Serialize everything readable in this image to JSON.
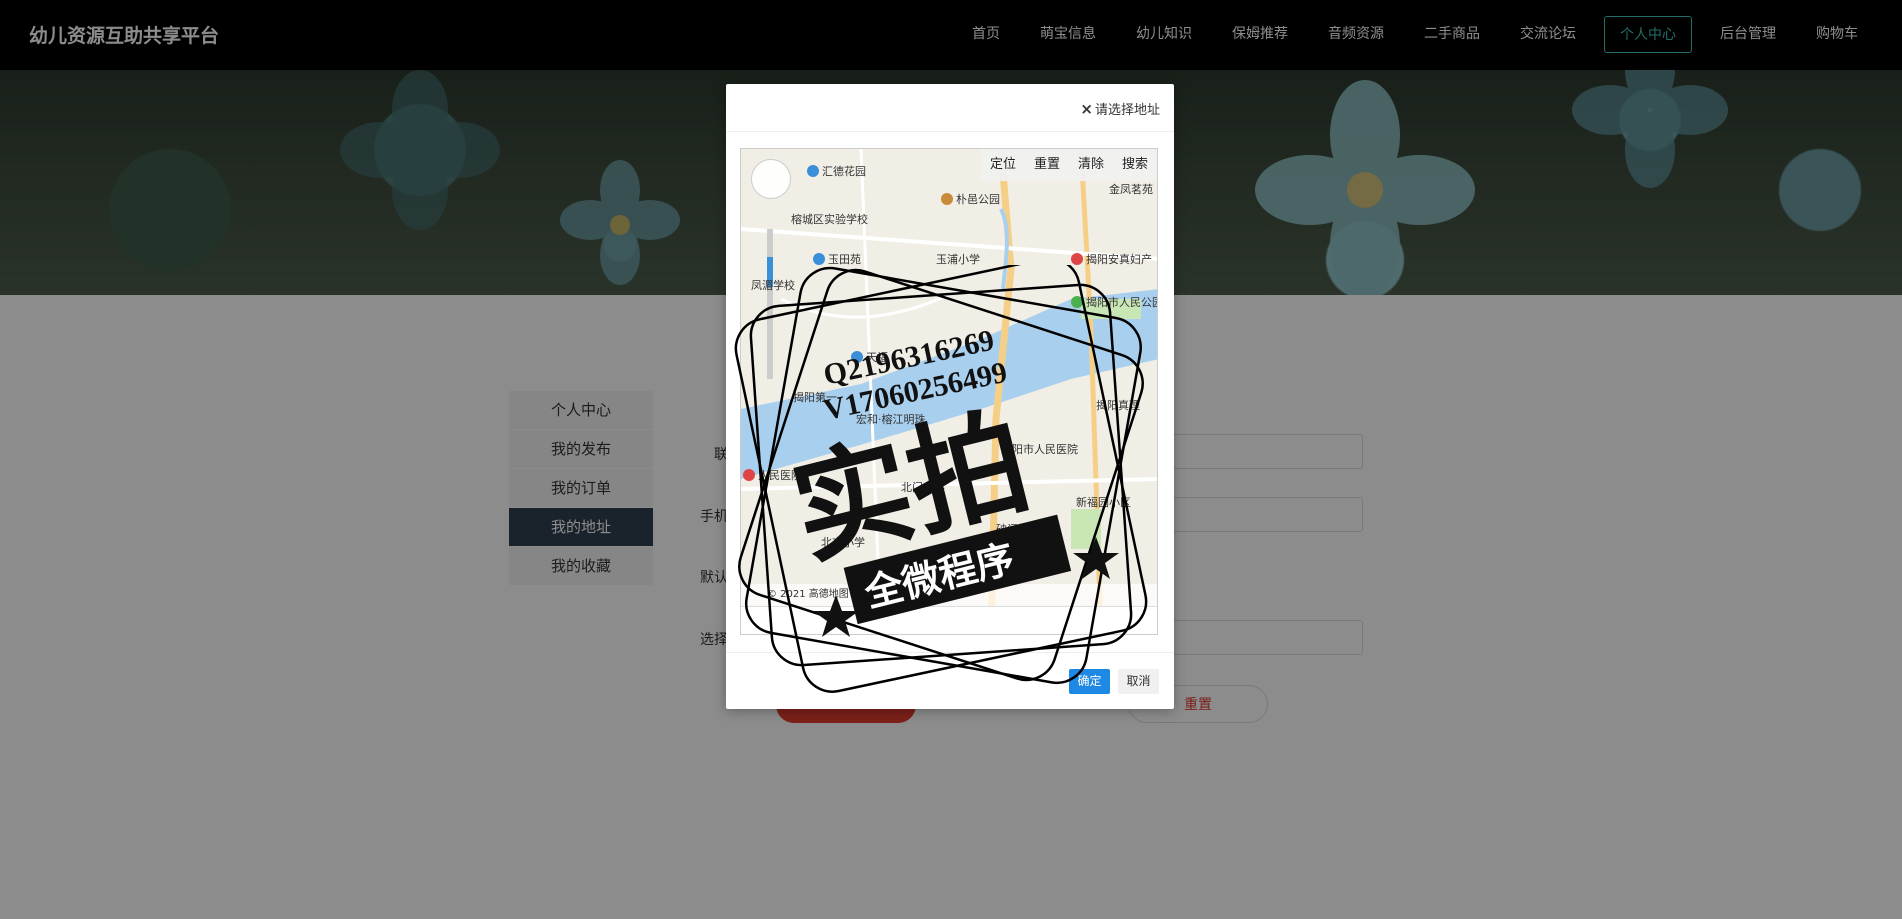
{
  "brand": "幼儿资源互助共享平台",
  "nav": [
    {
      "label": "首页",
      "active": false
    },
    {
      "label": "萌宝信息",
      "active": false
    },
    {
      "label": "幼儿知识",
      "active": false
    },
    {
      "label": "保姆推荐",
      "active": false
    },
    {
      "label": "音频资源",
      "active": false
    },
    {
      "label": "二手商品",
      "active": false
    },
    {
      "label": "交流论坛",
      "active": false
    },
    {
      "label": "个人中心",
      "active": true
    },
    {
      "label": "后台管理",
      "active": false
    },
    {
      "label": "购物车",
      "active": false
    }
  ],
  "sidebar": {
    "items": [
      {
        "label": "个人中心",
        "active": false
      },
      {
        "label": "我的发布",
        "active": false
      },
      {
        "label": "我的订单",
        "active": false
      },
      {
        "label": "我的地址",
        "active": true
      },
      {
        "label": "我的收藏",
        "active": false
      }
    ]
  },
  "form": {
    "labels": [
      "联",
      "手机",
      "默认",
      "选择"
    ],
    "reset_label": "重置"
  },
  "modal": {
    "title": "请选择地址",
    "close_icon": "×",
    "map_tools": [
      "定位",
      "重置",
      "清除",
      "搜索"
    ],
    "ok_label": "确定",
    "cancel_label": "取消",
    "pois": [
      "汇德花园",
      "榕城区实验学校",
      "朴邑公园",
      "金凤茗苑",
      "玉田苑",
      "玉浦小学",
      "揭阳安真妇产",
      "凤湄学校",
      "揭阳市人民公园",
      "揭阳真理",
      "人民医院",
      "北门小学",
      "新福园小区",
      "北市小学",
      "揭阳学宫",
      "破门楼郑",
      "宏和·榕江明珠",
      "揭阳第一",
      "揭阳市人民医院",
      "天福"
    ],
    "map_copyright": "© 2021 高德地图"
  },
  "watermark": {
    "line1": "Q2196316269",
    "line2": "V17060256499",
    "big": "实拍",
    "ribbon": "全微程序"
  }
}
